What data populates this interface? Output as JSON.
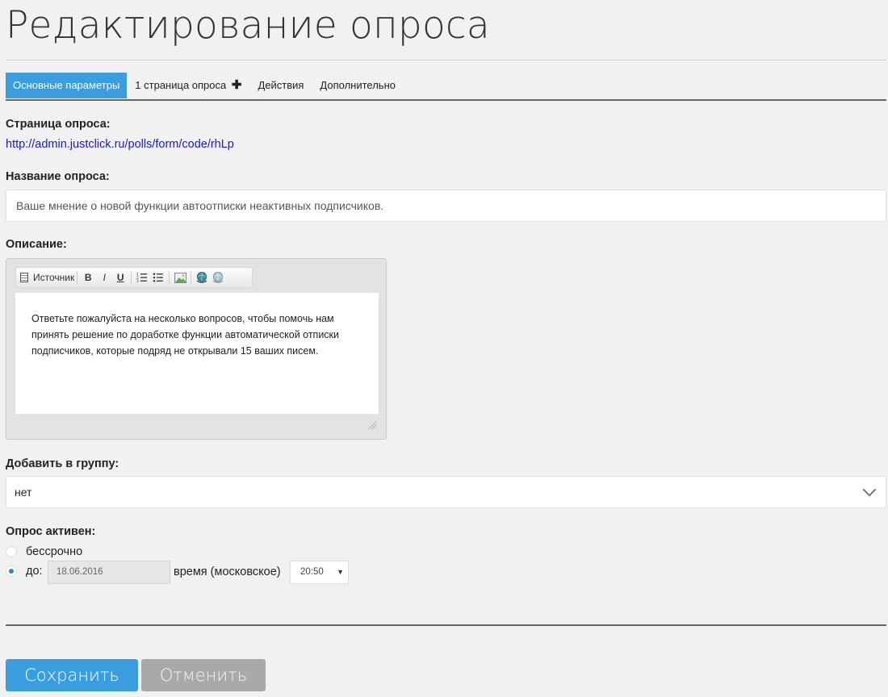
{
  "page": {
    "title": "Редактирование опроса"
  },
  "tabs": [
    {
      "label": "Основные параметры",
      "active": true
    },
    {
      "label": "1 страница опроса",
      "plus": "✚"
    },
    {
      "label": "Действия"
    },
    {
      "label": "Дополнительно"
    }
  ],
  "poll_page": {
    "label": "Страница опроса:",
    "url": "http://admin.justclick.ru/polls/form/code/rhLp"
  },
  "poll_name": {
    "label": "Название опроса:",
    "value": "Ваше мнение о новой функции автоотписки неактивных подписчиков."
  },
  "description": {
    "label": "Описание:",
    "toolbar": {
      "source_label": "Источник",
      "bold": "B",
      "italic": "I",
      "underline": "U"
    },
    "text": "Ответьте пожалуйста на несколько вопросов, чтобы помочь нам принять решение по доработке функции автоматической отписки подписчиков, которые подряд не открывали 15 ваших писем."
  },
  "group": {
    "label": "Добавить в группу:",
    "selected": "нет"
  },
  "active": {
    "label": "Опрос активен:",
    "option_forever": "бессрочно",
    "option_until": "до:",
    "date": "18.06.2016",
    "time_label": "время (московское)",
    "time": "20:50",
    "time_arrow": "▼"
  },
  "buttons": {
    "save": "Сохранить",
    "cancel": "Отменить"
  },
  "colors": {
    "accent": "#3a9ddd",
    "cancel": "#a8a9ab",
    "link": "#1a1ad8"
  }
}
